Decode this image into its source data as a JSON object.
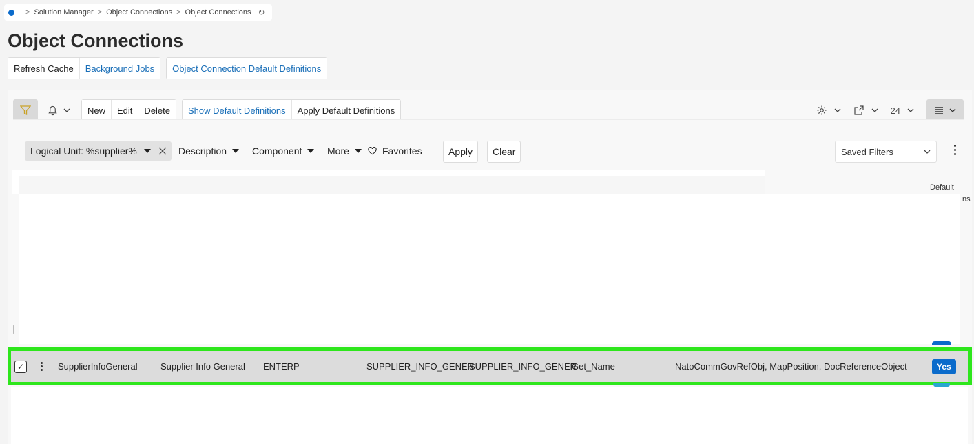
{
  "breadcrumb": {
    "items": [
      "Solution Manager",
      "Object Connections",
      "Object Connections"
    ]
  },
  "page": {
    "title": "Object Connections"
  },
  "top_actions": {
    "refresh_cache": "Refresh Cache",
    "background_jobs": "Background Jobs",
    "default_definitions": "Object Connection Default Definitions"
  },
  "toolbar": {
    "new": "New",
    "edit": "Edit",
    "delete": "Delete",
    "show_default": "Show Default Definitions",
    "apply_default": "Apply Default Definitions",
    "page_size": "24"
  },
  "filters": {
    "chip": "Logical Unit: %supplier%",
    "description": "Description",
    "component": "Component",
    "more": "More",
    "favorites": "Favorites",
    "apply": "Apply",
    "clear": "Clear",
    "saved_filters": "Saved Filters"
  },
  "table": {
    "col_default": "Default",
    "col_fragment": "ns"
  },
  "row": {
    "logical_unit": "SupplierInfoGeneral",
    "description": "Supplier Info General",
    "component": "ENTERP",
    "col4": "SUPPLIER_INFO_GENER",
    "col5": "SUPPLIER_INFO_GENER",
    "method": "Get_Name",
    "connections": "NatoCommGovRefObj, MapPosition, DocReferenceObject",
    "default": "Yes"
  },
  "colors": {
    "accent": "#0b6bcb",
    "link": "#1a6fb8",
    "highlight": "#2ee61c",
    "favorites_heart": "#222"
  }
}
